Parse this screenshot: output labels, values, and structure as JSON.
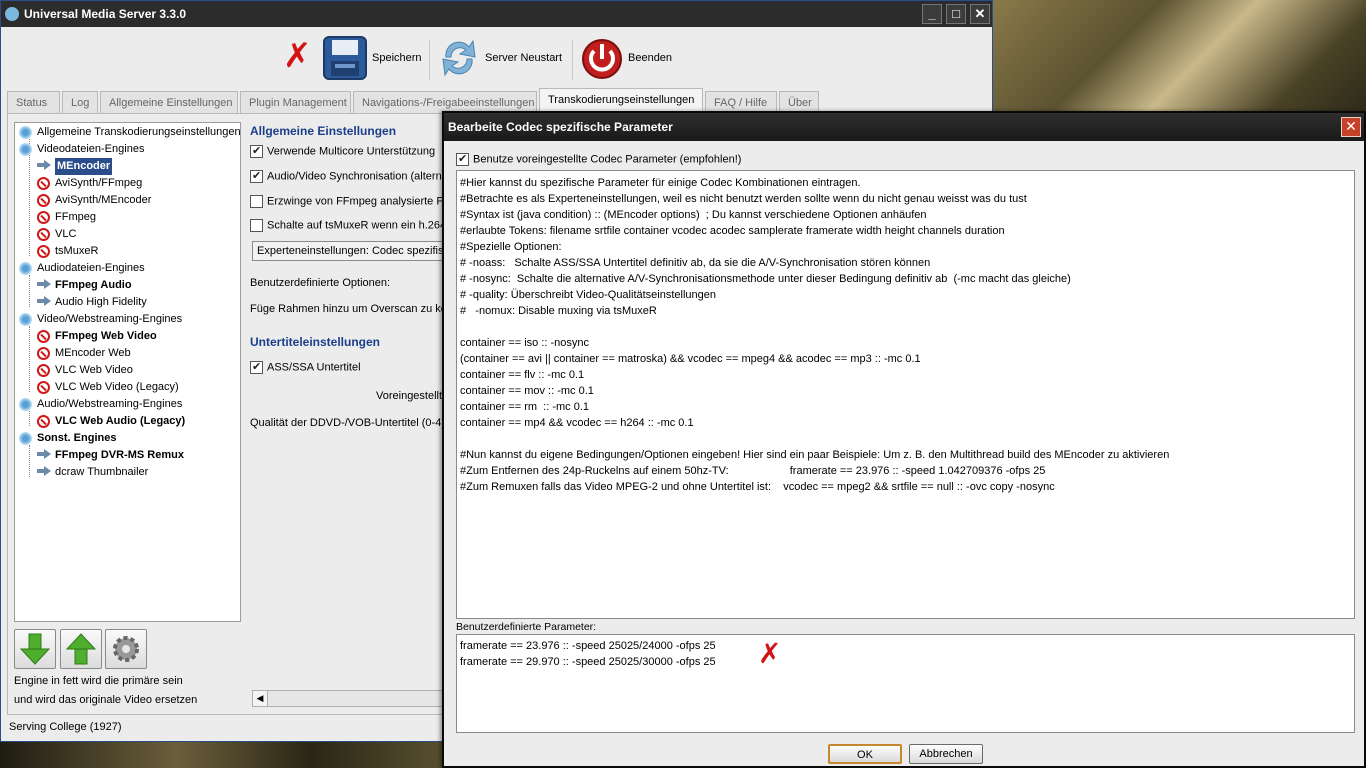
{
  "window": {
    "title": "Universal Media Server 3.3.0",
    "controls": [
      "_",
      "□",
      "✕"
    ]
  },
  "toolbar": {
    "save_label": "Speichern",
    "restart_label": "Server Neustart",
    "quit_label": "Beenden"
  },
  "tabs": [
    {
      "label": "Status"
    },
    {
      "label": "Log"
    },
    {
      "label": "Allgemeine Einstellungen"
    },
    {
      "label": "Plugin Management"
    },
    {
      "label": "Navigations-/Freigabeeinstellungen"
    },
    {
      "label": "Transkodierungseinstellungen",
      "active": true
    },
    {
      "label": "FAQ / Hilfe"
    },
    {
      "label": "Über"
    }
  ],
  "tree": {
    "items": [
      {
        "label": "Allgemeine Transkodierungseinstellungen",
        "icon": "snowflake-icon",
        "level": 0,
        "bold": false
      },
      {
        "label": "Videodateien-Engines",
        "icon": "snowflake-icon",
        "level": 0,
        "bold": false
      },
      {
        "label": "MEncoder",
        "icon": "arrow-icon",
        "level": 1,
        "bold": true,
        "selected": true
      },
      {
        "label": "AviSynth/FFmpeg",
        "icon": "disabled-icon",
        "level": 1,
        "bold": false
      },
      {
        "label": "AviSynth/MEncoder",
        "icon": "disabled-icon",
        "level": 1,
        "bold": false
      },
      {
        "label": "FFmpeg",
        "icon": "disabled-icon",
        "level": 1,
        "bold": false
      },
      {
        "label": "VLC",
        "icon": "disabled-icon",
        "level": 1,
        "bold": false
      },
      {
        "label": "tsMuxeR",
        "icon": "disabled-icon",
        "level": 1,
        "bold": false
      },
      {
        "label": "Audiodateien-Engines",
        "icon": "snowflake-icon",
        "level": 0,
        "bold": false
      },
      {
        "label": "FFmpeg Audio",
        "icon": "arrow-icon",
        "level": 1,
        "bold": true
      },
      {
        "label": "Audio High Fidelity",
        "icon": "arrow-icon",
        "level": 1,
        "bold": false
      },
      {
        "label": "Video/Webstreaming-Engines",
        "icon": "snowflake-icon",
        "level": 0,
        "bold": false
      },
      {
        "label": "FFmpeg Web Video",
        "icon": "disabled-icon",
        "level": 1,
        "bold": true
      },
      {
        "label": "MEncoder Web",
        "icon": "disabled-icon",
        "level": 1,
        "bold": false
      },
      {
        "label": "VLC Web Video",
        "icon": "disabled-icon",
        "level": 1,
        "bold": false
      },
      {
        "label": "VLC Web Video (Legacy)",
        "icon": "disabled-icon",
        "level": 1,
        "bold": false
      },
      {
        "label": "Audio/Webstreaming-Engines",
        "icon": "snowflake-icon",
        "level": 0,
        "bold": false
      },
      {
        "label": "VLC Web Audio (Legacy)",
        "icon": "disabled-icon",
        "level": 1,
        "bold": true
      },
      {
        "label": "Sonst. Engines",
        "icon": "snowflake-icon",
        "level": 0,
        "bold": true
      },
      {
        "label": "FFmpeg DVR-MS Remux",
        "icon": "arrow-icon",
        "level": 1,
        "bold": true
      },
      {
        "label": "dcraw Thumbnailer",
        "icon": "arrow-icon",
        "level": 1,
        "bold": false
      }
    ]
  },
  "engine_note": {
    "line1": "Engine in fett wird die primäre sein",
    "line2": "und wird das originale Video ersetzen"
  },
  "settings": {
    "general_title": "Allgemeine Einstellungen",
    "multicore": "Verwende Multicore Unterstützung",
    "av_sync": "Audio/Video Synchronisation (alterna",
    "force_ffmpeg": "Erzwinge von FFmpeg analysierte Fr",
    "tsmuxer": "Schalte auf tsMuxeR wenn ein h.264",
    "expert_combo": "Experteneinstellungen: Codec spezifisc",
    "custom_options": "Benutzerdefinierte Optionen:",
    "overscan": "Füge Rahmen hinzu um Overscan zu kor",
    "subtitle_title": "Untertiteleinstellungen",
    "ass_ssa": "ASS/SSA Untertitel",
    "default_partial": "Voreingestellt",
    "dvd_quality": "Qualität der DDVD-/VOB-Untertitel (0-4)"
  },
  "status_bar": {
    "text": "Serving College (1927)"
  },
  "dialog": {
    "title": "Bearbeite Codec spezifische Parameter",
    "use_default_label": "Benutze voreingestellte Codec Parameter (empfohlen!)",
    "use_default_checked": true,
    "code_text": "#Hier kannst du spezifische Parameter für einige Codec Kombinationen eintragen.\n#Betrachte es als Experteneinstellungen, weil es nicht benutzt werden sollte wenn du nicht genau weisst was du tust\n#Syntax ist (java condition) :: (MEncoder options)  ; Du kannst verschiedene Optionen anhäufen\n#erlaubte Tokens: filename srtfile container vcodec acodec samplerate framerate width height channels duration\n#Spezielle Optionen:\n# -noass:   Schalte ASS/SSA Untertitel definitiv ab, da sie die A/V-Synchronisation stören können\n# -nosync:  Schalte die alternative A/V-Synchronisationsmethode unter dieser Bedingung definitiv ab  (-mc macht das gleiche)\n# -quality: Überschreibt Video-Qualitätseinstellungen\n#   -nomux: Disable muxing via tsMuxeR\n\ncontainer == iso :: -nosync\n(container == avi || container == matroska) && vcodec == mpeg4 && acodec == mp3 :: -mc 0.1\ncontainer == flv :: -mc 0.1\ncontainer == mov :: -mc 0.1\ncontainer == rm  :: -mc 0.1\ncontainer == mp4 && vcodec == h264 :: -mc 0.1\n\n#Nun kannst du eigene Bedingungen/Optionen eingeben! Hier sind ein paar Beispiele: Um z. B. den Multithread build des MEncoder zu aktivieren\n#Zum Entfernen des 24p-Ruckelns auf einem 50hz-TV:                    framerate == 23.976 :: -speed 1.042709376 -ofps 25\n#Zum Remuxen falls das Video MPEG-2 und ohne Untertitel ist:    vcodec == mpeg2 && srtfile == null :: -ovc copy -nosync",
    "user_params_label": "Benutzerdefinierte Parameter:",
    "user_params_text": "framerate == 23.976 :: -speed 25025/24000 -ofps 25\nframerate == 29.970 :: -speed 25025/30000 -ofps 25",
    "ok_label": "OK",
    "cancel_label": "Abbrechen"
  }
}
